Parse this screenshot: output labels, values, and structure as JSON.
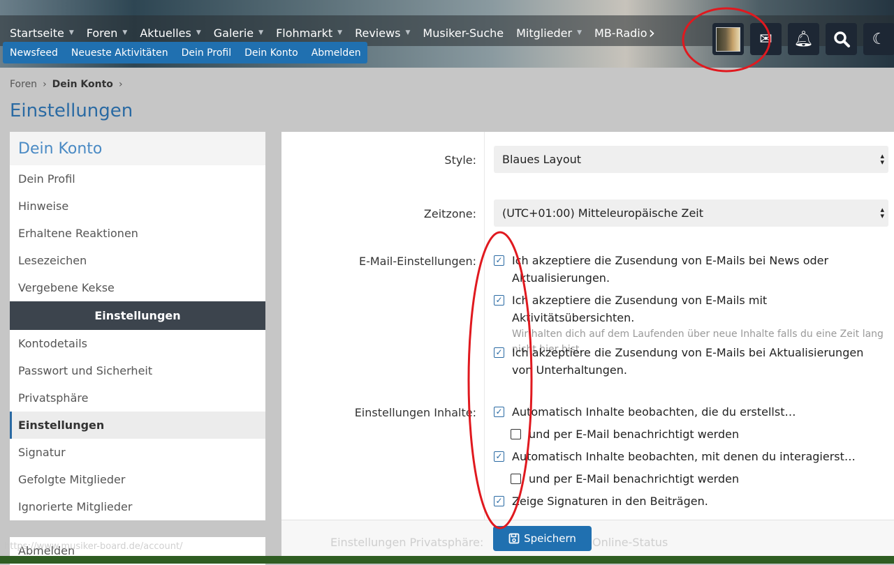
{
  "nav": {
    "items": [
      {
        "label": "Startseite",
        "caret": true
      },
      {
        "label": "Foren",
        "caret": true
      },
      {
        "label": "Aktuelles",
        "caret": true
      },
      {
        "label": "Galerie",
        "caret": true
      },
      {
        "label": "Flohmarkt",
        "caret": true
      },
      {
        "label": "Reviews",
        "caret": true
      },
      {
        "label": "Musiker-Suche",
        "caret": false
      },
      {
        "label": "Mitglieder",
        "caret": true
      },
      {
        "label": "MB-Radio",
        "caret": false
      }
    ]
  },
  "subnav": [
    "Newsfeed",
    "Neueste Aktivitäten",
    "Dein Profil",
    "Dein Konto",
    "Abmelden"
  ],
  "breadcrumb": [
    "Foren",
    "Dein Konto"
  ],
  "page_title": "Einstellungen",
  "sidebar": {
    "header": "Dein Konto",
    "items1": [
      "Dein Profil",
      "Hinweise",
      "Erhaltene Reaktionen",
      "Lesezeichen",
      "Vergebene Kekse"
    ],
    "section": "Einstellungen",
    "items2": [
      "Kontodetails",
      "Passwort und Sicherheit",
      "Privatsphäre",
      "Einstellungen",
      "Signatur",
      "Gefolgte Mitglieder",
      "Ignorierte Mitglieder"
    ],
    "selected": "Einstellungen",
    "logout": "Abmelden"
  },
  "form": {
    "style_label": "Style:",
    "style_value": "Blaues Layout",
    "tz_label": "Zeitzone:",
    "tz_value": "(UTC+01:00) Mitteleuropäische Zeit",
    "email_label": "E-Mail-Einstellungen:",
    "email": [
      {
        "text": "Ich akzeptiere die Zusendung von E-Mails bei News oder Aktualisierungen.",
        "checked": true
      },
      {
        "text": "Ich akzeptiere die Zusendung von E-Mails mit Aktivitätsübersichten.",
        "hint": "Wir halten dich auf dem Laufenden über neue Inhalte falls du eine Zeit lang nicht hier bist.",
        "checked": true
      },
      {
        "text": "Ich akzeptiere die Zusendung von E-Mails bei Aktualisierungen von Unterhaltungen.",
        "checked": true
      }
    ],
    "content_label": "Einstellungen Inhalte:",
    "content": [
      {
        "text": "Automatisch Inhalte beobachten, die du erstellst…",
        "checked": true
      },
      {
        "text": "und per E-Mail benachrichtigt werden",
        "checked": false
      },
      {
        "text": "Automatisch Inhalte beobachten, mit denen du interagierst…",
        "checked": true
      },
      {
        "text": "und per E-Mail benachrichtigt werden",
        "checked": false
      },
      {
        "text": "Zeige Signaturen in den Beiträgen.",
        "checked": true
      }
    ],
    "privacy_label": "Einstellungen Privatsphäre:",
    "privacy_value": "Online-Status",
    "save": "Speichern"
  },
  "status_url": "https://www.musiker-board.de/account/",
  "colors": {
    "accent": "#2070b0",
    "annotation": "#e0191f"
  }
}
